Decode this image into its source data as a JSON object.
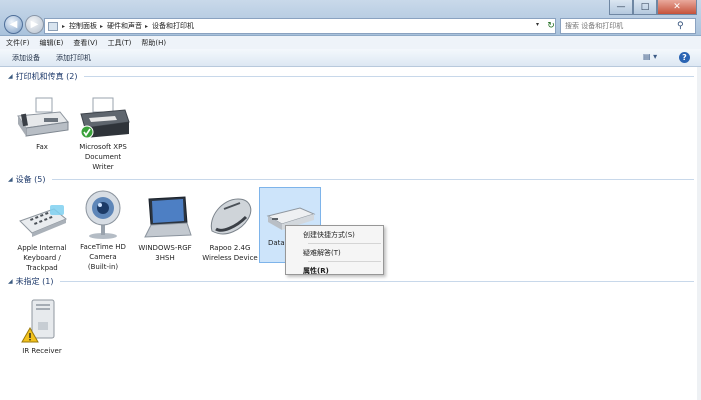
{
  "window": {
    "minimize": "—",
    "maximize": "□",
    "close": "✕"
  },
  "nav": {
    "back": "◀",
    "forward": "▶",
    "dropdown": "▾"
  },
  "address": {
    "crumbs": [
      "控制面板",
      "硬件和声音",
      "设备和打印机"
    ],
    "separator": "▸",
    "dropdown": "▾",
    "refresh": "↻"
  },
  "search": {
    "placeholder": "搜索 设备和打印机",
    "icon": "search-icon"
  },
  "menu": {
    "file": "文件(F)",
    "edit": "编辑(E)",
    "view": "查看(V)",
    "tools": "工具(T)",
    "help": "帮助(H)"
  },
  "toolbar": {
    "add_device": "添加设备",
    "add_printer": "添加打印机",
    "view": "▤ ▾",
    "help": "?"
  },
  "groups": {
    "printers": {
      "title": "打印机和传真 (2)"
    },
    "devices": {
      "title": "设备 (5)"
    },
    "unspecified": {
      "title": "未指定 (1)"
    }
  },
  "printers": [
    {
      "line1": "Fax",
      "line2": "",
      "line3": ""
    },
    {
      "line1": "Microsoft XPS",
      "line2": "Document",
      "line3": "Writer"
    }
  ],
  "devices": [
    {
      "line1": "Apple Internal",
      "line2": "Keyboard /",
      "line3": "Trackpad"
    },
    {
      "line1": "FaceTime HD",
      "line2": "Camera",
      "line3": "(Built-in)"
    },
    {
      "line1": "WINDOWS-RGF",
      "line2": "3HSH",
      "line3": ""
    },
    {
      "line1": "Rapoo 2.4G",
      "line2": "Wireless Device",
      "line3": ""
    },
    {
      "line1": "Data",
      "line2": "",
      "line3": ""
    }
  ],
  "unspecified": [
    {
      "line1": "IR Receiver"
    }
  ],
  "context_menu": {
    "create_shortcut": "创建快捷方式(S)",
    "troubleshoot": "疑难解答(T)",
    "properties": "属性(R)"
  }
}
